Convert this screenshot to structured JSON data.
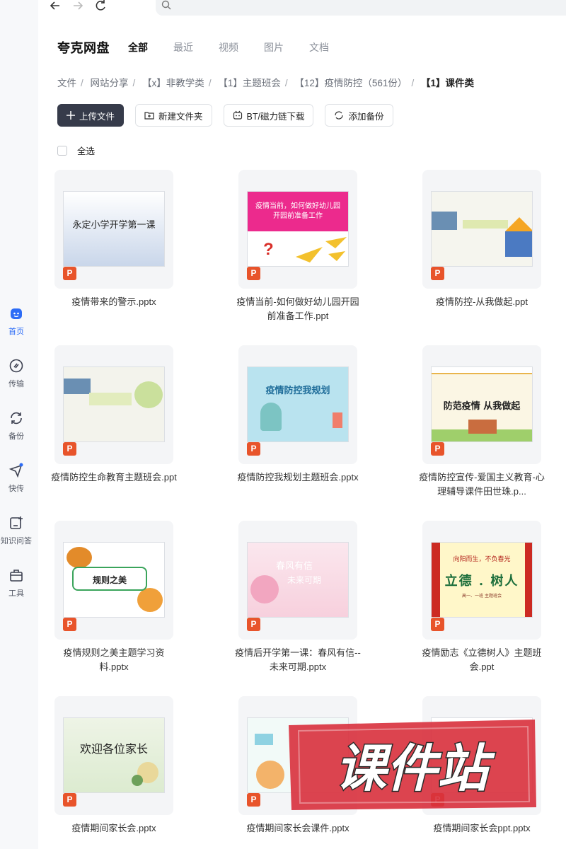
{
  "browser": {
    "back_icon": "arrow-left-icon",
    "forward_icon": "arrow-right-icon",
    "reload_icon": "reload-icon",
    "search_icon": "search-icon"
  },
  "sidebar": {
    "items": [
      {
        "label": "首页",
        "icon": "home-face-icon",
        "active": true
      },
      {
        "label": "传输",
        "icon": "transfer-icon"
      },
      {
        "label": "备份",
        "icon": "backup-icon"
      },
      {
        "label": "快传",
        "icon": "send-icon"
      },
      {
        "label": "知识问答",
        "icon": "qa-icon"
      },
      {
        "label": "工具",
        "icon": "toolbox-icon"
      }
    ]
  },
  "header": {
    "title": "夸克网盘",
    "tabs": [
      "全部",
      "最近",
      "视频",
      "图片",
      "文档"
    ]
  },
  "breadcrumb": [
    "文件",
    "网站分享",
    "【x】非教学类",
    "【1】主题班会",
    "【12】疫情防控（561份）",
    "【1】课件类"
  ],
  "toolbar": {
    "upload": "上传文件",
    "new_folder": "新建文件夹",
    "bt": "BT/磁力链下载",
    "backup": "添加备份"
  },
  "select_all": "全选",
  "files": [
    {
      "name": "疫情带来的警示.pptx",
      "thumb_title": "永定小学开学第一课"
    },
    {
      "name": "疫情当前-如何做好幼儿园开园前准备工作.ppt",
      "thumb_title": "疫情当前，如何做好幼儿园开园前准备工作"
    },
    {
      "name": "疫情防控-从我做起.ppt",
      "thumb_title": ""
    },
    {
      "name": "疫情防控生命教育主题班会.ppt",
      "thumb_title": ""
    },
    {
      "name": "疫情防控我规划主题班会.pptx",
      "thumb_title": "疫情防控我规划"
    },
    {
      "name": "疫情防控宣传-爱国主义教育-心理辅导课件田世珠.p...",
      "thumb_title": "防范疫情 从我做起"
    },
    {
      "name": "疫情规则之美主题学习资料.pptx",
      "thumb_title": "规则之美"
    },
    {
      "name": "疫情后开学第一课：春风有信--未来可期.pptx",
      "thumb_title": "春风有信"
    },
    {
      "name": "疫情励志《立德树人》主题班会.ppt",
      "thumb_title": "立德 . 树人"
    },
    {
      "name": "疫情期间家长会.pptx",
      "thumb_title": "欢迎各位家长"
    },
    {
      "name": "疫情期间家长会课件.pptx",
      "thumb_title": ""
    },
    {
      "name": "疫情期间家长会ppt.pptx",
      "thumb_title": ""
    }
  ],
  "thumb_extra": {
    "lide_sub": "向阳而生，不负春光",
    "lide_class": "高一、一班 主题班会",
    "chunfeng_sub": "未来可期"
  },
  "file_badge": "P",
  "watermark": "课件站",
  "colors": {
    "accent": "#2d6cf6",
    "primary_button": "#363b4a",
    "ppt_badge": "#e8542b",
    "watermark": "#d8303c"
  }
}
